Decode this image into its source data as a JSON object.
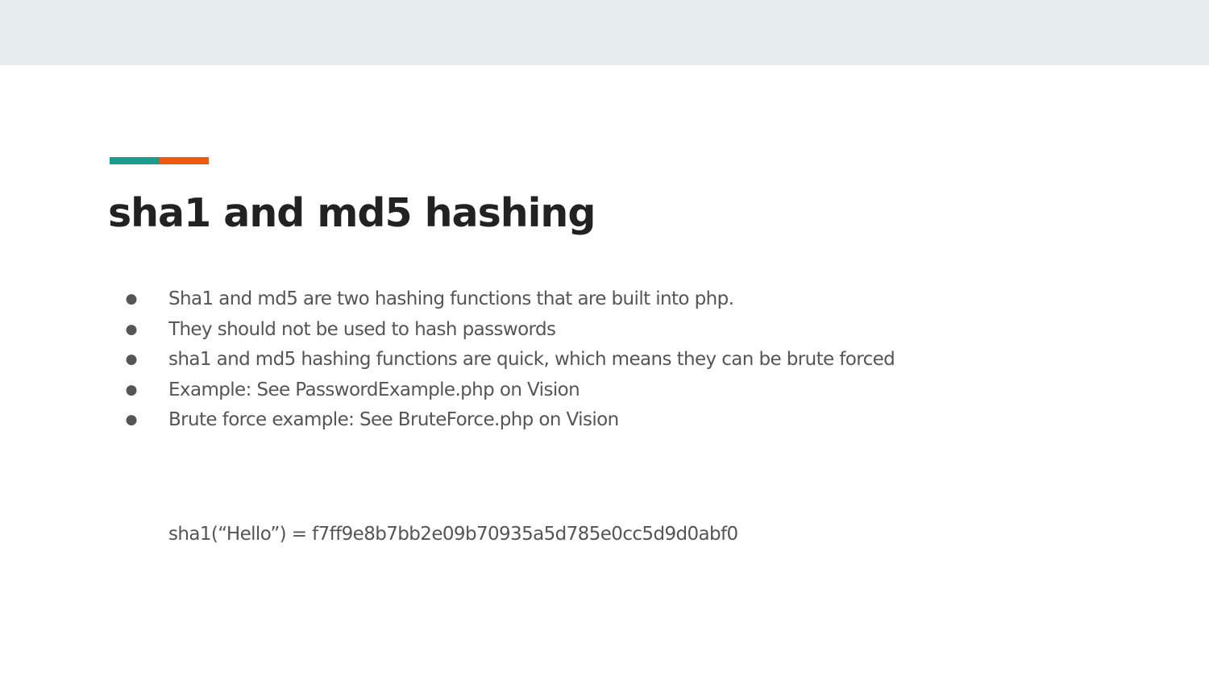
{
  "colors": {
    "top_band": "#e8eeee",
    "accent_teal": "#1a9c8e",
    "accent_orange": "#f05a0e",
    "title": "#222222",
    "body_text": "#555555"
  },
  "slide": {
    "title": "sha1 and md5 hashing",
    "bullet_marker": "●",
    "bullets": [
      "Sha1 and md5 are two hashing functions that are built into php.",
      "They should not be used to hash passwords",
      "sha1 and md5 hashing functions are quick, which means they can be brute forced",
      "Example: See PasswordExample.php on Vision",
      "Brute force example: See BruteForce.php on Vision"
    ],
    "code_example": "sha1(“Hello”) = f7ff9e8b7bb2e09b70935a5d785e0cc5d9d0abf0"
  }
}
